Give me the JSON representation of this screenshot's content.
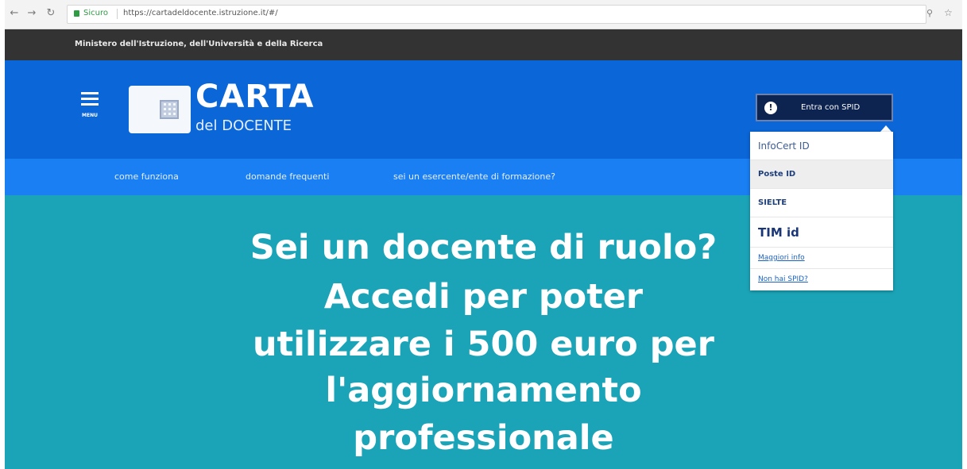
{
  "browser": {
    "back_icon": "←",
    "forward_icon": "→",
    "reload_icon": "↻",
    "secure_label": "Sicuro",
    "url": "https://cartadeldocente.istruzione.it/#/",
    "zoom_icon": "⚲",
    "star_icon": "☆"
  },
  "ministry": {
    "text": "Ministero dell'Istruzione, dell'Università e della Ricerca"
  },
  "header": {
    "menu_label": "MENU",
    "logo_title": "CARTA",
    "logo_subtitle": "del DOCENTE",
    "spid_icon": "!",
    "spid_button": "Entra con SPID"
  },
  "nav": {
    "items": [
      "come funziona",
      "domande frequenti",
      "sei un esercente/ente di formazione?"
    ]
  },
  "hero": {
    "lines": [
      "Sei un docente di ruolo?",
      "Accedi per poter",
      "utilizzare i 500 euro per",
      "l'aggiornamento",
      "professionale"
    ]
  },
  "dropdown": {
    "providers": [
      "InfoCert ID",
      "Poste ID",
      "SIELTE",
      "TIM id"
    ],
    "link_more": "Maggiori info",
    "link_no_spid": "Non hai SPID?"
  },
  "colors": {
    "header_blue": "#0b66d8",
    "nav_blue": "#1a7ff2",
    "hero_teal": "#1ba4b7",
    "ministry_dark": "#333334",
    "spid_navy": "#0d2350"
  }
}
